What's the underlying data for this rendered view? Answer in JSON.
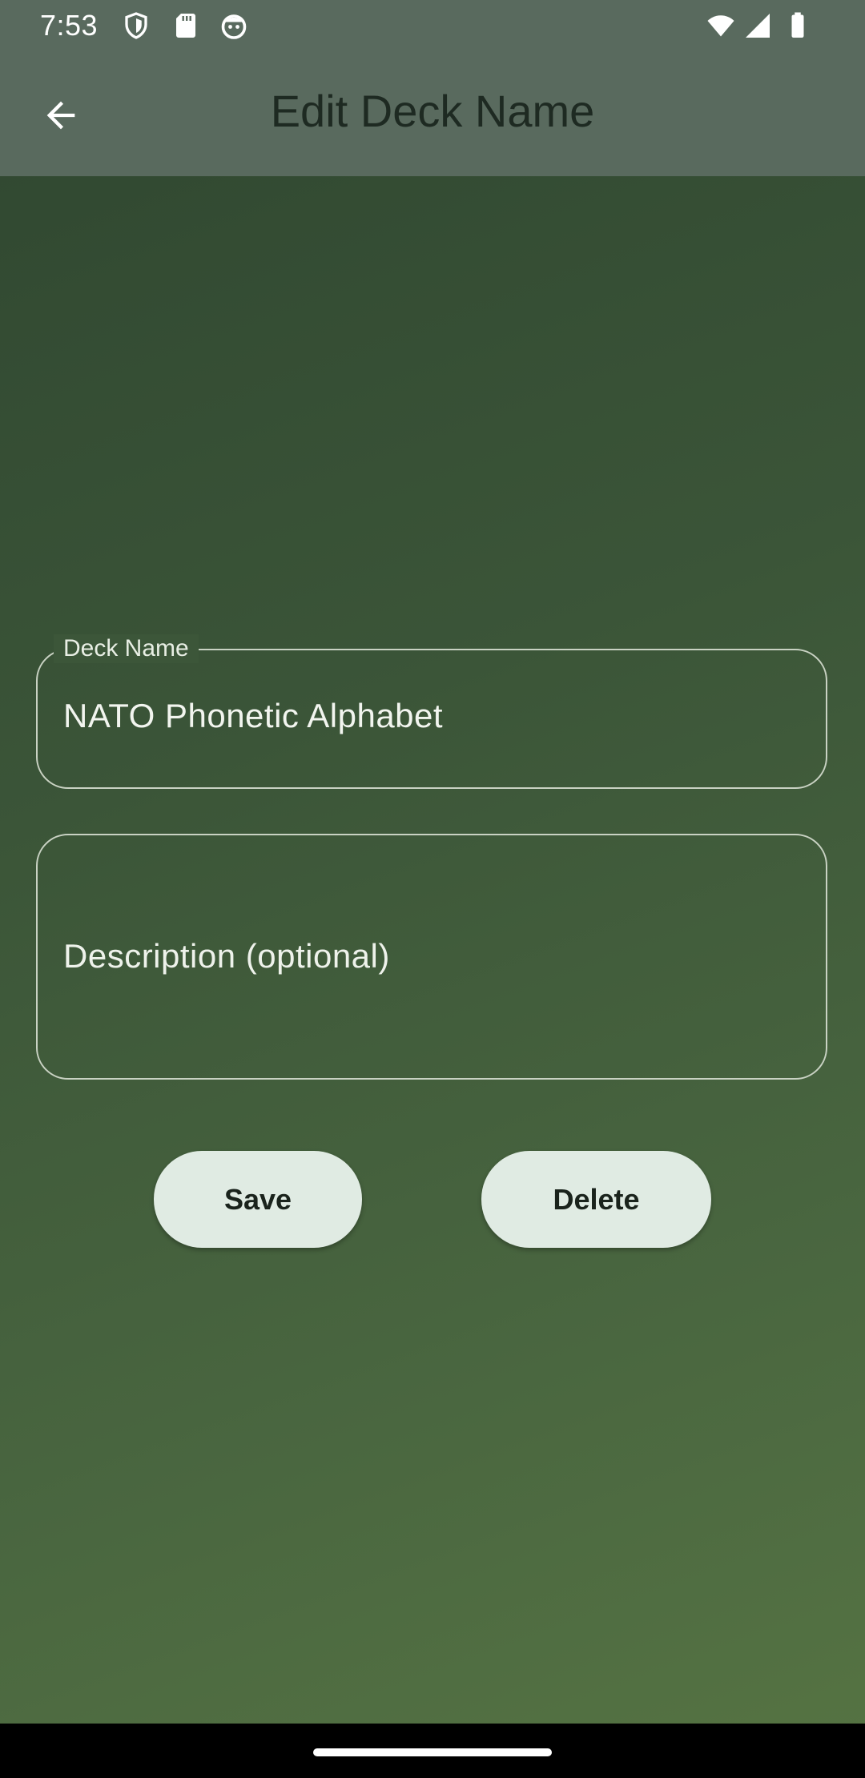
{
  "status_bar": {
    "time": "7:53",
    "left_icons": [
      "shield-icon",
      "sd-card-icon",
      "android-debug-icon"
    ],
    "right_icons": [
      "wifi-icon",
      "cellular-signal-icon",
      "battery-icon"
    ]
  },
  "app_bar": {
    "title": "Edit Deck Name",
    "back_icon": "arrow-back-icon"
  },
  "form": {
    "deck_name": {
      "label": "Deck Name",
      "value": "NATO Phonetic Alphabet"
    },
    "description": {
      "placeholder": "Description (optional)",
      "value": ""
    }
  },
  "actions": {
    "save_label": "Save",
    "delete_label": "Delete"
  },
  "colors": {
    "app_bar": "#596a5e",
    "background_top": "#2f4630",
    "background_bottom": "#567443",
    "button_fill": "#e0ebe3",
    "field_border": "#c9d2c3"
  }
}
